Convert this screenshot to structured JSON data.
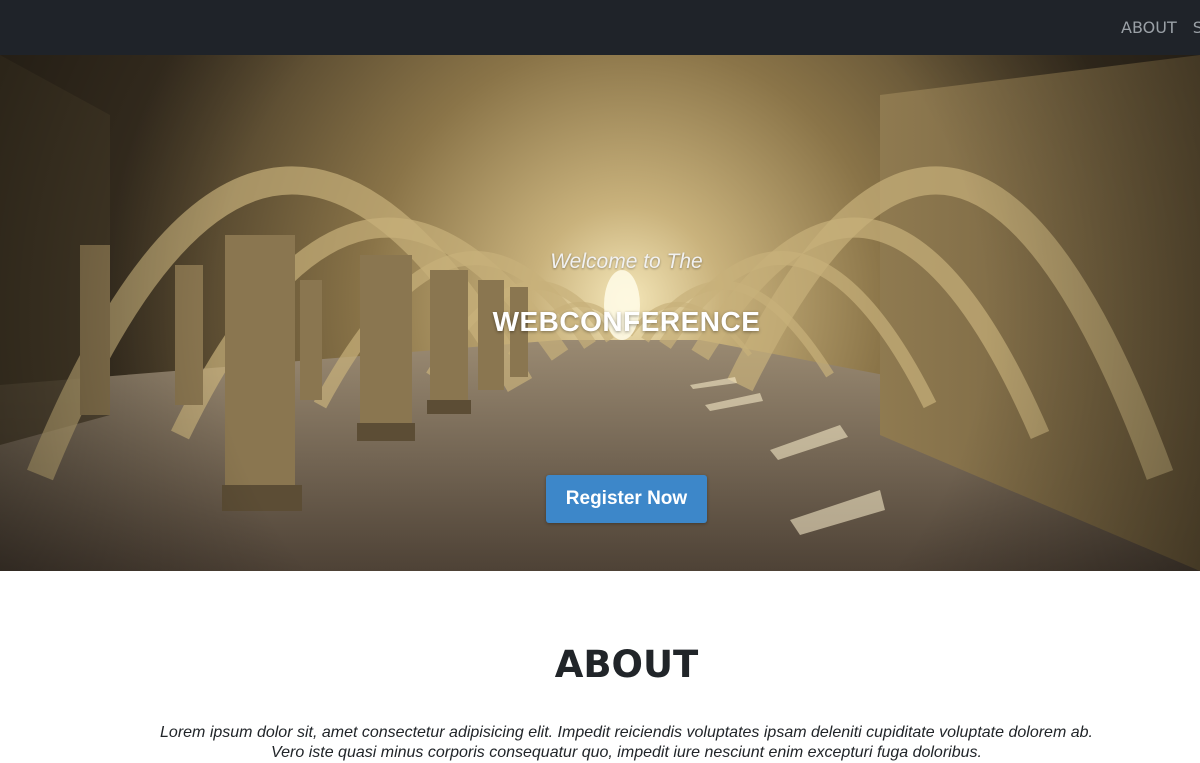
{
  "nav": {
    "items": [
      {
        "label": "ABOUT"
      },
      {
        "label": "S"
      }
    ]
  },
  "hero": {
    "subtitle": "Welcome to The",
    "title": "WEBCONFERENCE",
    "cta_label": "Register Now"
  },
  "about": {
    "heading": "ABOUT",
    "text_line1": "Lorem ipsum dolor sit, amet consectetur adipisicing elit. Impedit reiciendis voluptates ipsam deleniti cupiditate voluptate dolorem ab.",
    "text_line2": "Vero iste quasi minus corporis consequatur quo, impedit iure nesciunt enim excepturi fuga doloribus."
  },
  "colors": {
    "navbar_bg": "#1f2329",
    "nav_link": "#9aa0a6",
    "cta_bg": "#3d87c9",
    "text_dark": "#212529"
  },
  "icons": {
    "hero_image": "stone-arched-cloister-photo"
  }
}
